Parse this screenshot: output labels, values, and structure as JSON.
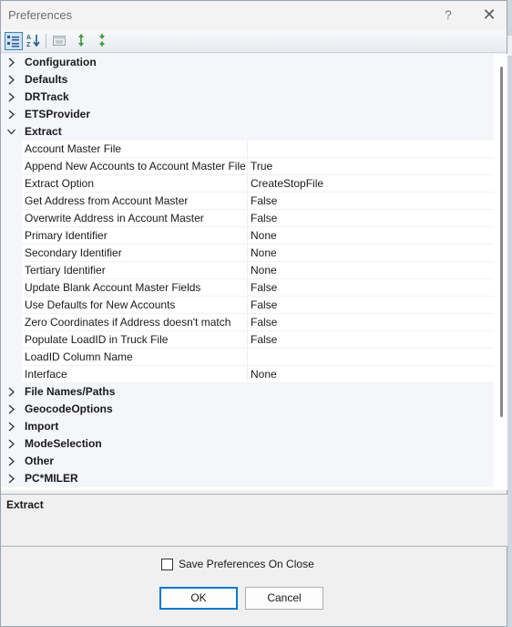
{
  "window": {
    "title": "Preferences",
    "help_glyph": "?",
    "close_glyph": "✕"
  },
  "toolbar": {
    "buttons": [
      {
        "name": "categorized-view",
        "icon": "categorized-icon",
        "active": true
      },
      {
        "name": "alphabetical-sort",
        "icon": "sort-az-icon",
        "active": false
      },
      {
        "name": "property-pages",
        "icon": "property-pages-icon",
        "active": false
      },
      {
        "name": "expand-all",
        "icon": "expand-all-icon",
        "active": false
      },
      {
        "name": "collapse-all",
        "icon": "collapse-all-icon",
        "active": false
      }
    ]
  },
  "grid": {
    "categories_before": [
      {
        "label": "Configuration"
      },
      {
        "label": "Defaults"
      },
      {
        "label": "DRTrack"
      },
      {
        "label": "ETSProvider"
      }
    ],
    "expanded_category": {
      "label": "Extract",
      "properties": [
        {
          "name": "Account Master File",
          "value": ""
        },
        {
          "name": "Append New Accounts to Account Master File",
          "value": "True"
        },
        {
          "name": "Extract Option",
          "value": "CreateStopFile"
        },
        {
          "name": "Get Address from Account Master",
          "value": "False"
        },
        {
          "name": "Overwrite Address in Account Master",
          "value": "False"
        },
        {
          "name": "Primary Identifier",
          "value": "None"
        },
        {
          "name": "Secondary Identifier",
          "value": "None"
        },
        {
          "name": "Tertiary Identifier",
          "value": "None"
        },
        {
          "name": "Update Blank Account Master Fields",
          "value": "False"
        },
        {
          "name": "Use Defaults for New Accounts",
          "value": "False"
        },
        {
          "name": "Zero Coordinates if Address doesn't match",
          "value": "False"
        },
        {
          "name": "Populate LoadID in Truck File",
          "value": "False"
        },
        {
          "name": "LoadID Column Name",
          "value": ""
        },
        {
          "name": "Interface",
          "value": "None"
        }
      ]
    },
    "categories_after": [
      {
        "label": "File Names/Paths"
      },
      {
        "label": "GeocodeOptions"
      },
      {
        "label": "Import"
      },
      {
        "label": "ModeSelection"
      },
      {
        "label": "Other"
      },
      {
        "label": "PC*MILER"
      }
    ]
  },
  "description": {
    "title": "Extract"
  },
  "footer": {
    "save_on_close_label": "Save Preferences On Close",
    "save_on_close_checked": false,
    "ok_label": "OK",
    "cancel_label": "Cancel"
  },
  "colors": {
    "accent": "#0078d4",
    "category_bg": "#f4f6f9"
  }
}
